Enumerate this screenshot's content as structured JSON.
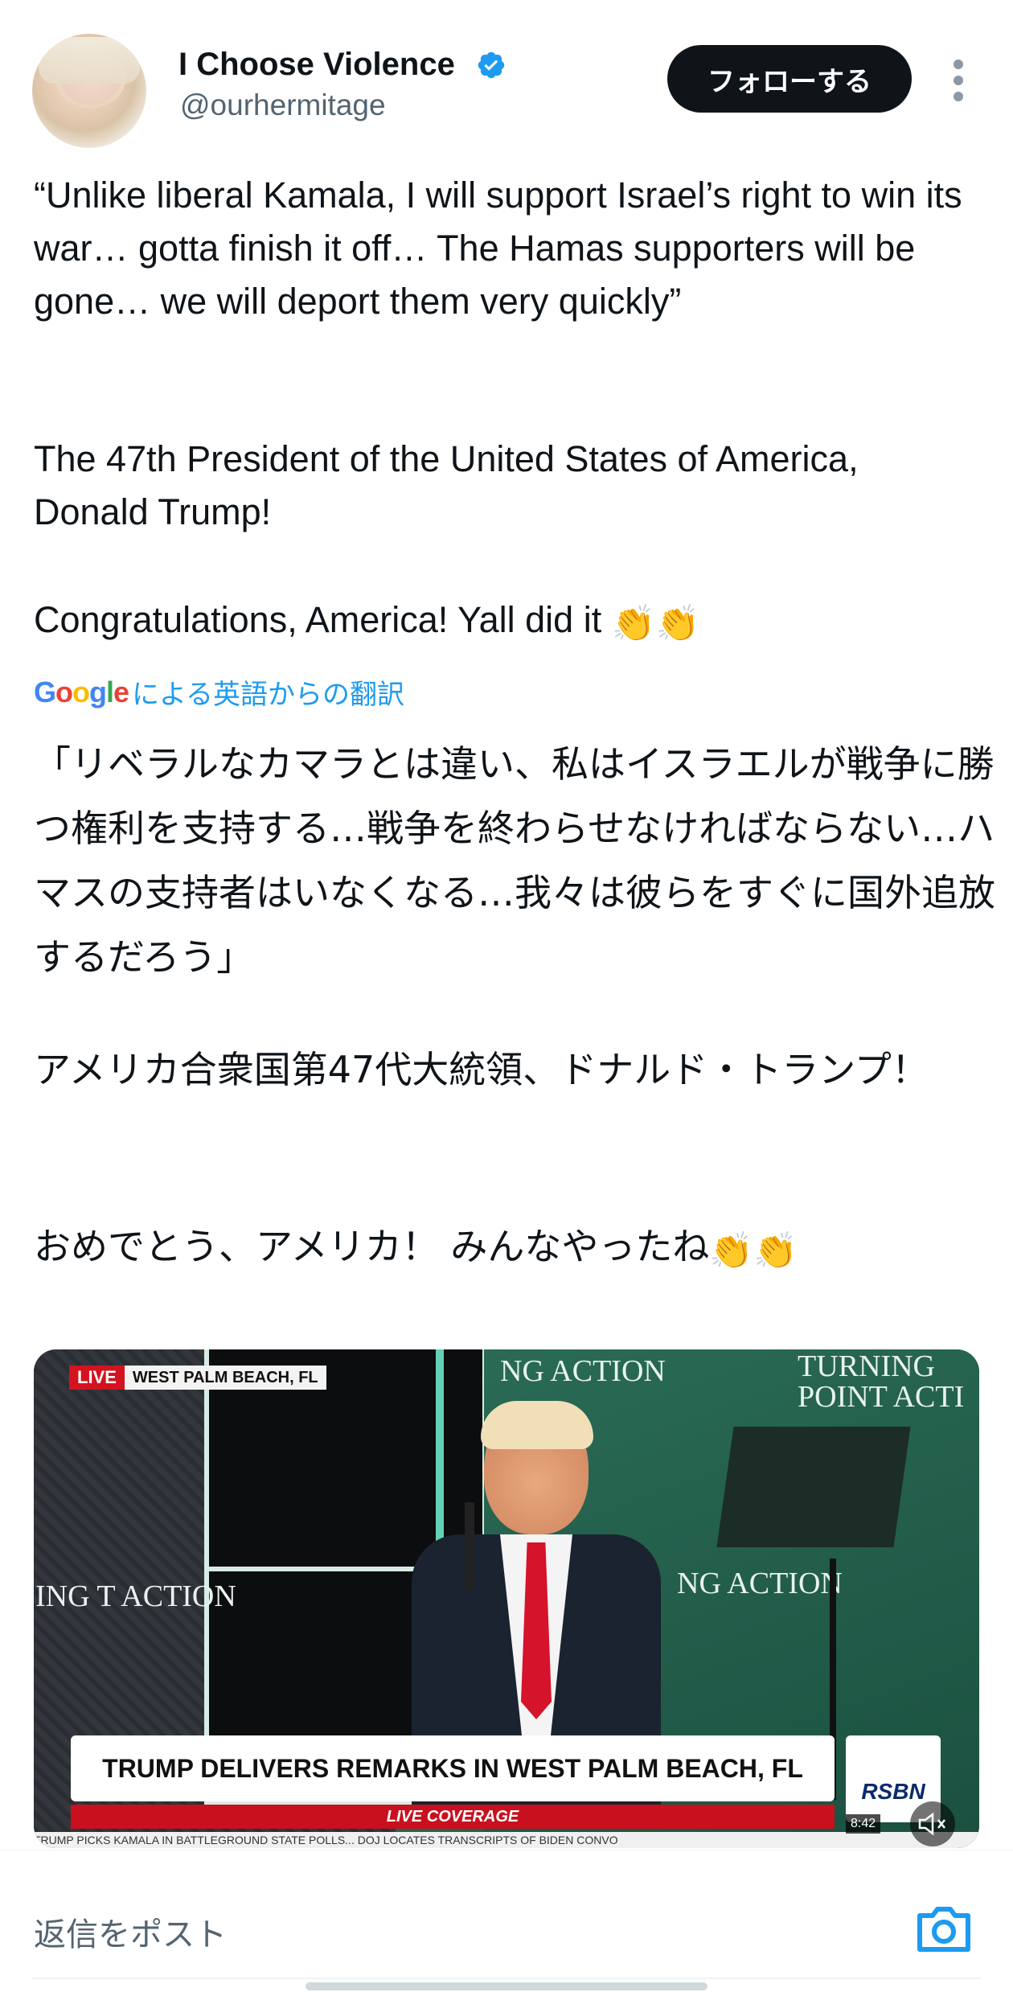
{
  "tweet": {
    "author_name": "I Choose Violence",
    "author_handle": "@ourhermitage",
    "follow_label": "フォローする",
    "para1": "“Unlike liberal Kamala, I will support Israel’s right to win its war… gotta finish it off… The Hamas supporters will be gone… we will deport them very quickly”",
    "para2": "The 47th President of the United States of America, Donald Trump!",
    "para3": "Congratulations, America! Yall did it",
    "translate_label": "による英語からの翻訳",
    "google_logo": "Google",
    "jp1": "「リベラルなカマラとは違い、私はイスラエルが戦争に勝つ権利を支持する…戦争を終わらせなければならない…ハマスの支持者はいなくなる…我々は彼らをすぐに国外追放するだろう」",
    "jp2": "アメリカ合衆国第47代大統領、ドナルド・トランプ！",
    "jp3": "おめでとう、アメリカ！ みんなやったね",
    "clap": "👏👏"
  },
  "video": {
    "live_label": "LIVE",
    "location": "WEST PALM BEACH, FL",
    "headline": "TRUMP DELIVERS REMARKS IN WEST PALM BEACH, FL",
    "coverage": "LIVE COVERAGE",
    "network": "RSBN",
    "time": "8:42",
    "ticker": "TRUMP PICKS KAMALA IN BATTLEGROUND STATE POLLS... DOJ LOCATES TRANSCRIPTS OF BIDEN CONVO",
    "backdrop_text_1": "NG ACTION",
    "backdrop_text_2": "TURNING POINT ACTI",
    "backdrop_text_3": "ING T ACTION",
    "backdrop_text_4": "NG ACTION"
  },
  "reply": {
    "placeholder": "返信をポスト"
  },
  "colors": {
    "accent": "#1d9bf0",
    "follow_bg": "#0f1419",
    "live_red": "#d3131f"
  }
}
